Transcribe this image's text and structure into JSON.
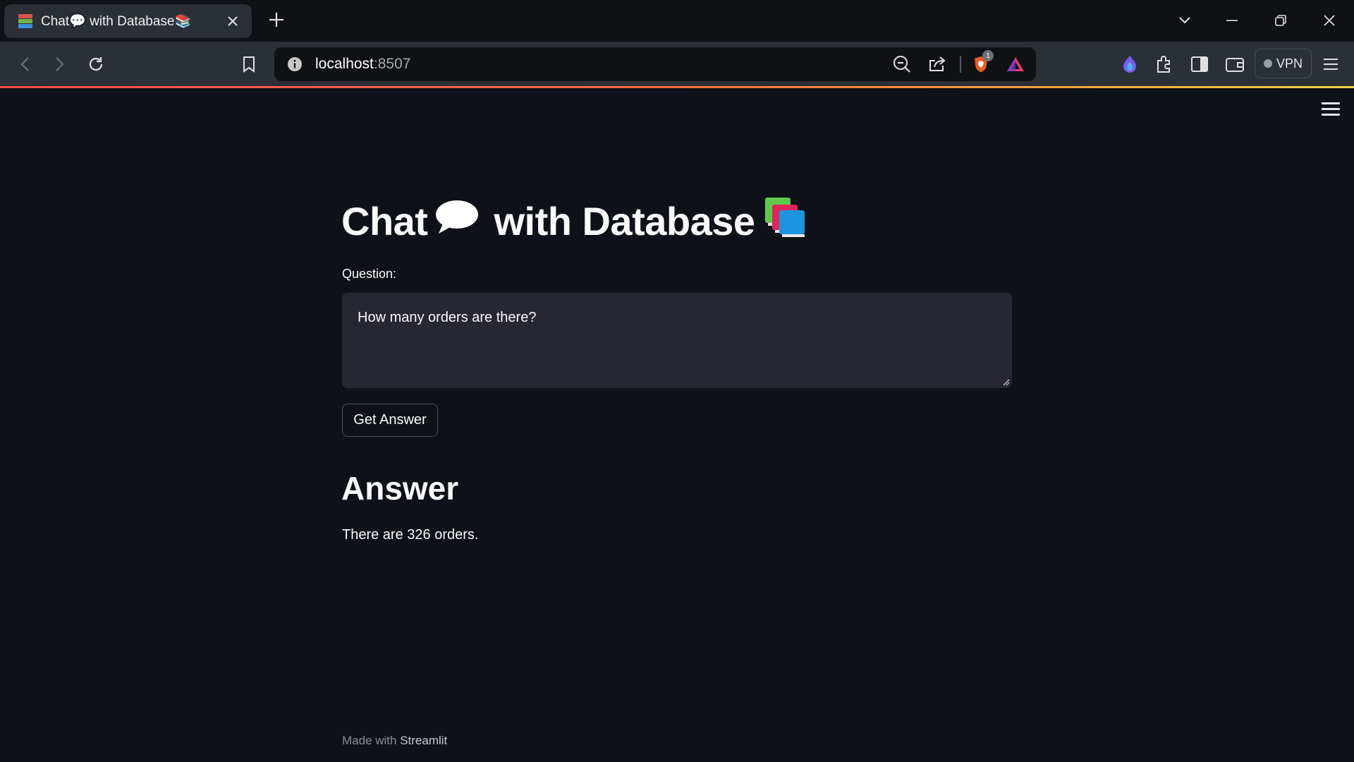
{
  "browser": {
    "tab": {
      "title": "Chat💬 with Database📚"
    },
    "address": {
      "host": "localhost",
      "port": ":8507"
    },
    "vpn_label": "VPN",
    "brave_badge": "1"
  },
  "app": {
    "title_part1": "Chat",
    "title_part2": "with Database",
    "question": {
      "label": "Question:",
      "value": "How many orders are there?"
    },
    "button_label": "Get Answer",
    "answer_heading": "Answer",
    "answer_text": "There are 326 orders.",
    "footer": {
      "prefix": "Made with ",
      "brand": "Streamlit"
    }
  },
  "colors": {
    "background": "#0e1117",
    "input_bg": "#262730",
    "chrome_bg": "#2b2f36",
    "accent_gradient": [
      "#ff4b4b",
      "#ffd23f"
    ]
  },
  "icons": [
    "speech-bubble-icon",
    "books-icon",
    "back-icon",
    "forward-icon",
    "reload-icon",
    "bookmark-icon",
    "site-info-icon",
    "zoom-out-icon",
    "share-icon",
    "brave-shields-icon",
    "brave-rewards-icon",
    "leo-icon",
    "extensions-icon",
    "sidebar-icon",
    "wallet-icon",
    "menu-icon"
  ]
}
